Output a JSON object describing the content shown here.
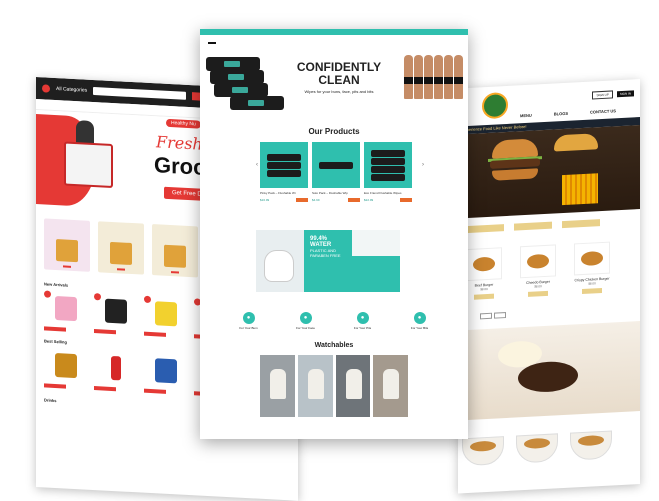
{
  "left": {
    "category_label": "All Categories",
    "hero": {
      "tag": "Healthy Nu",
      "line1": "Fresh Frui",
      "line2": "Grocer",
      "cta": "Get Free Delive"
    },
    "sections": {
      "new_arrivals": "New Arrivals",
      "best_selling": "Best Selling",
      "drinks": "Drinks"
    }
  },
  "center": {
    "title": "CONFIDENTLY CLEAN",
    "subtitle": "Wipes for your buns, face, pits and bits",
    "products_heading": "Our Products",
    "products": [
      {
        "name": "Pinky Pack – Flushable Wi",
        "price": "$16.99"
      },
      {
        "name": "Solo Pack – Flushable Wip",
        "price": "$4.99"
      },
      {
        "name": "Eco Friend Flushable Wipes",
        "price": "$22.99"
      }
    ],
    "feature": {
      "big": "99.4% WATER",
      "text": "PLASTIC AND PARABEN FREE"
    },
    "icon_labels": [
      "For Your Bum",
      "For Your Face",
      "For Your Pits",
      "For Your Bits"
    ],
    "watchables_heading": "Watchables"
  },
  "right": {
    "signup": "SIGN UP",
    "signin": "SIGN IN",
    "menu": [
      "MENU",
      "BLOGS",
      "CONTACT US"
    ],
    "banner": "Experience Food Like Never Before!",
    "items": [
      {
        "name": "Beef Burger",
        "price": "$8.00"
      },
      {
        "name": "Cheedo Burger",
        "price": "$8.00"
      },
      {
        "name": "Crispy Chicken Burger",
        "price": "$8.00"
      }
    ]
  }
}
